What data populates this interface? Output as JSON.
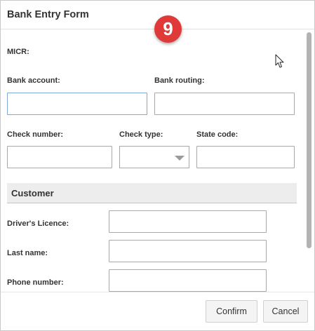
{
  "dialog": {
    "title": "Bank Entry Form",
    "step_badge": "9"
  },
  "form": {
    "micr_label": "MICR:",
    "bank_account_label": "Bank account:",
    "bank_account_value": "",
    "bank_routing_label": "Bank routing:",
    "bank_routing_value": "",
    "check_number_label": "Check number:",
    "check_number_value": "",
    "check_type_label": "Check type:",
    "check_type_selected": "",
    "state_code_label": "State code:",
    "state_code_value": ""
  },
  "customer": {
    "section_title": "Customer",
    "drivers_licence_label": "Driver's Licence:",
    "drivers_licence_value": "",
    "last_name_label": "Last name:",
    "last_name_value": "",
    "phone_number_label": "Phone number:",
    "phone_number_value": ""
  },
  "footer": {
    "confirm_label": "Confirm",
    "cancel_label": "Cancel"
  },
  "colors": {
    "badge": "#e0393a",
    "focus_border": "#7fa8d6",
    "section_bg": "#ededed"
  }
}
